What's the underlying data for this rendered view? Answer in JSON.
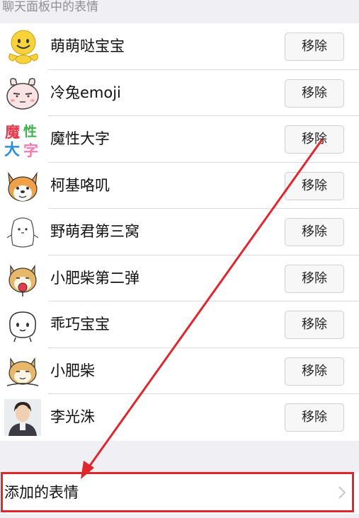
{
  "section_header": "聊天面板中的表情",
  "remove_label": "移除",
  "stickers": [
    {
      "name": "萌萌哒宝宝",
      "icon": "smiley-baby-icon"
    },
    {
      "name": "冷兔emoji",
      "icon": "cold-rabbit-icon"
    },
    {
      "name": "魔性大字",
      "icon": "magic-big-text-icon",
      "icon_text": [
        "魔",
        "性",
        "大",
        "字"
      ]
    },
    {
      "name": "柯基咯叽",
      "icon": "corgi-icon"
    },
    {
      "name": "野萌君第三窝",
      "icon": "wild-cute-icon"
    },
    {
      "name": "小肥柴第二弹",
      "icon": "shiba-lollipop-icon"
    },
    {
      "name": "乖巧宝宝",
      "icon": "good-baby-icon"
    },
    {
      "name": "小肥柴",
      "icon": "shiba-icon"
    },
    {
      "name": "李光洙",
      "icon": "person-photo-icon"
    }
  ],
  "added_stickers_label": "添加的表情",
  "annotation_color": "#e0272d"
}
